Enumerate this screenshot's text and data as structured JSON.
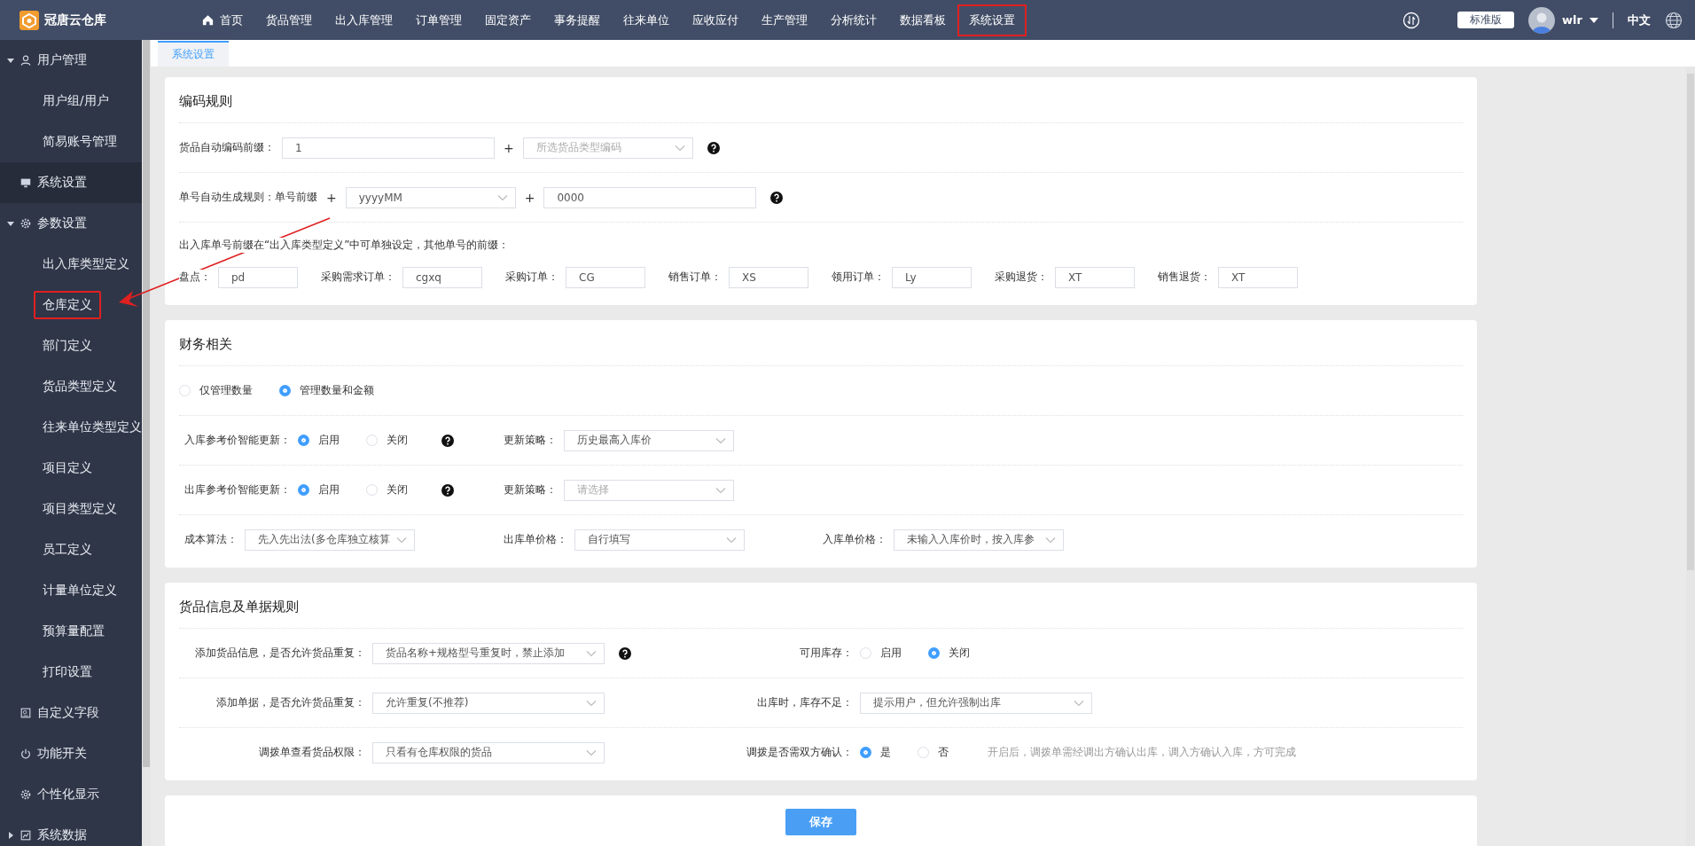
{
  "app": {
    "name": "冠唐云仓库"
  },
  "nav": {
    "items": [
      {
        "label": "首页",
        "highlighted": false
      },
      {
        "label": "货品管理",
        "highlighted": false
      },
      {
        "label": "出入库管理",
        "highlighted": false
      },
      {
        "label": "订单管理",
        "highlighted": false
      },
      {
        "label": "固定资产",
        "highlighted": false
      },
      {
        "label": "事务提醒",
        "highlighted": false
      },
      {
        "label": "往来单位",
        "highlighted": false
      },
      {
        "label": "应收应付",
        "highlighted": false
      },
      {
        "label": "生产管理",
        "highlighted": false
      },
      {
        "label": "分析统计",
        "highlighted": false
      },
      {
        "label": "数据看板",
        "highlighted": false
      },
      {
        "label": "系统设置",
        "highlighted": true
      }
    ]
  },
  "header": {
    "edition": "标准版",
    "user": "wlr",
    "language": "中文"
  },
  "sidebar": {
    "items": [
      {
        "label": "用户管理",
        "expanded": true,
        "selected": false,
        "children": [
          {
            "label": "用户组/用户",
            "selected": false,
            "highlighted": false
          },
          {
            "label": "简易账号管理",
            "selected": false,
            "highlighted": false
          }
        ]
      },
      {
        "label": "系统设置",
        "selected": true
      },
      {
        "label": "参数设置",
        "expanded": true,
        "selected": false,
        "children": [
          {
            "label": "出入库类型定义",
            "selected": false,
            "highlighted": false
          },
          {
            "label": "仓库定义",
            "selected": false,
            "highlighted": true
          },
          {
            "label": "部门定义",
            "selected": false,
            "highlighted": false
          },
          {
            "label": "货品类型定义",
            "selected": false,
            "highlighted": false
          },
          {
            "label": "往来单位类型定义",
            "selected": false,
            "highlighted": false
          },
          {
            "label": "项目定义",
            "selected": false,
            "highlighted": false
          },
          {
            "label": "项目类型定义",
            "selected": false,
            "highlighted": false
          },
          {
            "label": "员工定义",
            "selected": false,
            "highlighted": false
          },
          {
            "label": "计量单位定义",
            "selected": false,
            "highlighted": false
          },
          {
            "label": "预算量配置",
            "selected": false,
            "highlighted": false
          },
          {
            "label": "打印设置",
            "selected": false,
            "highlighted": false
          }
        ]
      },
      {
        "label": "自定义字段",
        "selected": false
      },
      {
        "label": "功能开关",
        "selected": false
      },
      {
        "label": "个性化显示",
        "selected": false
      },
      {
        "label": "系统数据",
        "expanded": false,
        "selected": false
      }
    ]
  },
  "tabs": [
    {
      "label": "系统设置",
      "selected": true
    }
  ],
  "sections": [
    {
      "title": "编码规则",
      "rows": [
        {
          "cells": [
            {
              "items": [
                {
                  "kind": "label",
                  "text": "货品自动编码前缀："
                },
                {
                  "kind": "input",
                  "value": "1"
                },
                {
                  "kind": "plus",
                  "text": "+"
                },
                {
                  "kind": "select",
                  "placeholder": "所选货品类型编码"
                },
                {
                  "kind": "help"
                }
              ]
            }
          ]
        },
        {
          "cells": [
            {
              "items": [
                {
                  "kind": "label",
                  "text": "单号自动生成规则：单号前缀"
                },
                {
                  "kind": "plus",
                  "text": "+"
                },
                {
                  "kind": "select",
                  "value": "yyyyMM"
                },
                {
                  "kind": "plus",
                  "text": "+"
                },
                {
                  "kind": "input",
                  "value": "0000"
                },
                {
                  "kind": "help"
                }
              ]
            }
          ]
        },
        {
          "cells": [
            {
              "items": [
                {
                  "kind": "note",
                  "text": "出入库单号前缀在“出入库类型定义”中可单独设定，其他单号的前缀："
                }
              ]
            }
          ]
        },
        {
          "cells": [
            {
              "items": [
                {
                  "kind": "label",
                  "text": "盘点："
                },
                {
                  "kind": "input",
                  "value": "pd"
                }
              ]
            },
            {
              "items": [
                {
                  "kind": "label",
                  "text": "采购需求订单："
                },
                {
                  "kind": "input",
                  "value": "cgxq"
                }
              ]
            },
            {
              "items": [
                {
                  "kind": "label",
                  "text": "采购订单："
                },
                {
                  "kind": "input",
                  "value": "CG"
                }
              ]
            },
            {
              "items": [
                {
                  "kind": "label",
                  "text": "销售订单："
                },
                {
                  "kind": "input",
                  "value": "XS"
                }
              ]
            },
            {
              "items": [
                {
                  "kind": "label",
                  "text": "领用订单："
                },
                {
                  "kind": "input",
                  "value": "Ly"
                }
              ]
            },
            {
              "items": [
                {
                  "kind": "label",
                  "text": "采购退货："
                },
                {
                  "kind": "input",
                  "value": "XT"
                }
              ]
            },
            {
              "items": [
                {
                  "kind": "label",
                  "text": "销售退货："
                },
                {
                  "kind": "input",
                  "value": "XT"
                }
              ]
            }
          ]
        }
      ]
    },
    {
      "title": "财务相关",
      "rows": [
        {
          "cells": [
            {
              "items": [
                {
                  "kind": "radio",
                  "text": "仅管理数量",
                  "selected": false
                },
                {
                  "kind": "radio",
                  "text": "管理数量和金额",
                  "selected": true
                }
              ]
            }
          ]
        },
        {
          "cells": [
            {
              "items": [
                {
                  "kind": "label",
                  "text": "入库参考价智能更新："
                },
                {
                  "kind": "radio",
                  "text": "启用",
                  "selected": true
                },
                {
                  "kind": "radio",
                  "text": "关闭",
                  "selected": false
                },
                {
                  "kind": "help"
                }
              ]
            },
            {
              "items": [
                {
                  "kind": "label",
                  "text": "更新策略："
                },
                {
                  "kind": "select",
                  "value": "历史最高入库价"
                }
              ]
            }
          ]
        },
        {
          "cells": [
            {
              "items": [
                {
                  "kind": "label",
                  "text": "出库参考价智能更新："
                },
                {
                  "kind": "radio",
                  "text": "启用",
                  "selected": true
                },
                {
                  "kind": "radio",
                  "text": "关闭",
                  "selected": false
                },
                {
                  "kind": "help"
                }
              ]
            },
            {
              "items": [
                {
                  "kind": "label",
                  "text": "更新策略："
                },
                {
                  "kind": "select",
                  "placeholder": "请选择"
                }
              ]
            }
          ]
        },
        {
          "cells": [
            {
              "items": [
                {
                  "kind": "label",
                  "text": "成本算法："
                },
                {
                  "kind": "select",
                  "value": "先入先出法(多仓库独立核算"
                }
              ]
            },
            {
              "items": [
                {
                  "kind": "label",
                  "text": "出库单价格："
                },
                {
                  "kind": "select",
                  "value": "自行填写"
                }
              ]
            },
            {
              "items": [
                {
                  "kind": "label",
                  "text": "入库单价格："
                },
                {
                  "kind": "select",
                  "value": "未输入入库价时，按入库参"
                }
              ]
            }
          ]
        }
      ]
    },
    {
      "title": "货品信息及单据规则",
      "rows": [
        {
          "cells": [
            {
              "items": [
                {
                  "kind": "label",
                  "text": "添加货品信息，是否允许货品重复："
                },
                {
                  "kind": "select",
                  "value": "货品名称+规格型号重复时，禁止添加"
                },
                {
                  "kind": "help"
                }
              ]
            },
            {
              "items": [
                {
                  "kind": "label",
                  "text": "可用库存："
                },
                {
                  "kind": "radio",
                  "text": "启用",
                  "selected": false
                },
                {
                  "kind": "radio",
                  "text": "关闭",
                  "selected": true
                }
              ]
            }
          ]
        },
        {
          "cells": [
            {
              "items": [
                {
                  "kind": "label",
                  "text": "添加单据，是否允许货品重复："
                },
                {
                  "kind": "select",
                  "value": "允许重复(不推荐)"
                }
              ]
            },
            {
              "items": [
                {
                  "kind": "label",
                  "text": "出库时，库存不足："
                },
                {
                  "kind": "select",
                  "value": "提示用户，但允许强制出库"
                }
              ]
            }
          ]
        },
        {
          "cells": [
            {
              "items": [
                {
                  "kind": "label",
                  "text": "调拨单查看货品权限："
                },
                {
                  "kind": "select",
                  "value": "只看有仓库权限的货品"
                }
              ]
            },
            {
              "items": [
                {
                  "kind": "label",
                  "text": "调拨是否需双方确认："
                },
                {
                  "kind": "radio",
                  "text": "是",
                  "selected": true
                },
                {
                  "kind": "radio",
                  "text": "否",
                  "selected": false
                },
                {
                  "kind": "note",
                  "text": "开启后，调拨单需经调出方确认出库，调入方确认入库，方可完成"
                }
              ]
            }
          ]
        }
      ]
    }
  ],
  "save_button": "保存"
}
